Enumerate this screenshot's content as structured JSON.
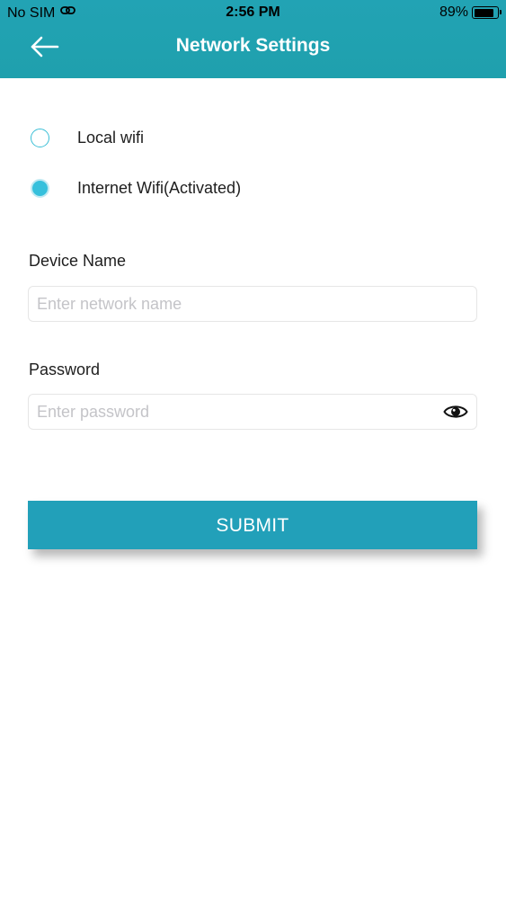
{
  "status_bar": {
    "carrier": "No SIM",
    "time": "2:56 PM",
    "battery_percent": "89%",
    "battery_level": 0.89
  },
  "nav": {
    "title": "Network Settings",
    "back_icon": "arrow-left-icon"
  },
  "network_mode": {
    "options": [
      {
        "label": "Local wifi",
        "selected": false
      },
      {
        "label": "Internet Wifi(Activated)",
        "selected": true
      }
    ]
  },
  "device_name": {
    "label": "Device Name",
    "value": "",
    "placeholder": "Enter network name"
  },
  "password": {
    "label": "Password",
    "value": "",
    "placeholder": "Enter password",
    "toggle_icon": "eye-icon"
  },
  "submit": {
    "label": "SUBMIT"
  },
  "colors": {
    "header": "#22a3b4",
    "accent": "#36c0dc",
    "button": "#22a0b9"
  }
}
